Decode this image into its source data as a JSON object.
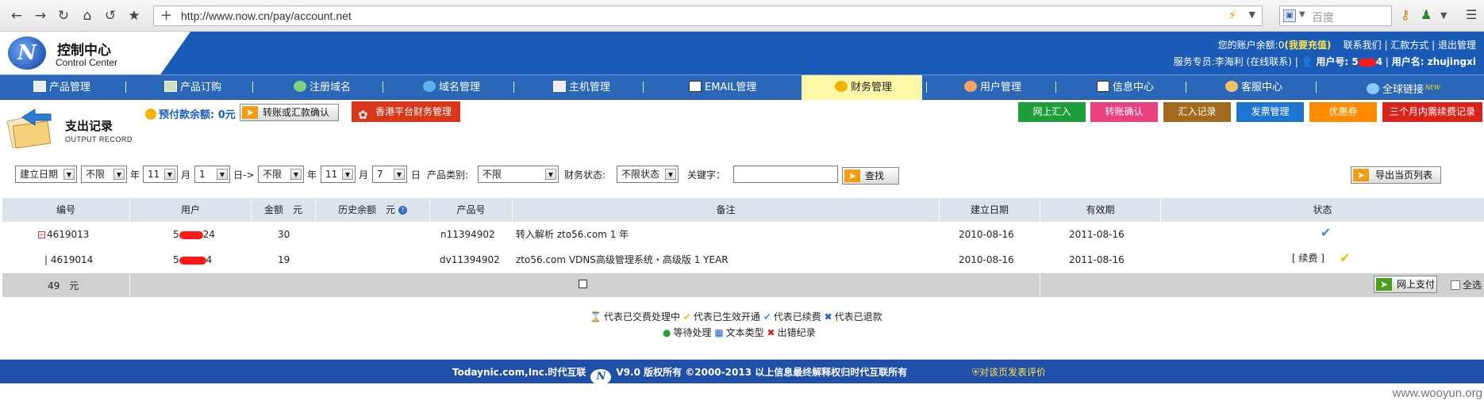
{
  "browser": {
    "url": "http://www.now.cn/pay/account.net",
    "search_placeholder": "百度"
  },
  "header": {
    "logo_cn": "控制中心",
    "logo_en": "Control Center",
    "balance_text": "您的账户余额:0",
    "recharge_link": "(我要充值)",
    "contact_link": "联系我们",
    "remit_link": "汇款方式",
    "logout_link": "退出管理",
    "service_text": "服务专员:李海利 (在线联系)",
    "account_no_label": "用户号: 5",
    "account_no_tail": "4",
    "username_label": "用户名: zhujingxi"
  },
  "nav": [
    {
      "label": "产品管理"
    },
    {
      "label": "产品订购"
    },
    {
      "label": "注册域名"
    },
    {
      "label": "域名管理"
    },
    {
      "label": "主机管理"
    },
    {
      "label": "EMAIL管理"
    },
    {
      "label": "财务管理"
    },
    {
      "label": "用户管理"
    },
    {
      "label": "信息中心"
    },
    {
      "label": "客服中心"
    },
    {
      "label": "全球链接"
    }
  ],
  "page": {
    "title": "支出记录",
    "subtitle": "OUTPUT RECORD",
    "prepaid_label": "预付款余额: 0元",
    "transfer_button": "转账或汇款确认",
    "hk_button": "香港平台财务管理"
  },
  "quick_buttons": [
    {
      "label": "网上汇入",
      "color": "#1e9e3a"
    },
    {
      "label": "转账确认",
      "color": "#e8417e"
    },
    {
      "label": "汇入记录",
      "color": "#a26a1c"
    },
    {
      "label": "发票管理",
      "color": "#1f76d1"
    },
    {
      "label": "优惠券",
      "color": "#ff8c00"
    },
    {
      "label": "三个月内需续费记录",
      "color": "#d9241c"
    }
  ],
  "filters": {
    "date_type": "建立日期",
    "from_year": "不限",
    "year_label": "年",
    "from_month": "11",
    "month_label": "月",
    "from_day": "1",
    "day_to_label": "日->",
    "to_year": "不限",
    "to_year_label": "年",
    "to_month": "11",
    "to_month_label": "月",
    "to_day": "7",
    "to_day_label": "日",
    "product_type_label": "产品类别:",
    "product_type": "不限",
    "finance_status_label": "财务状态:",
    "finance_status": "不限状态",
    "keyword_label": "关键字：",
    "keyword_value": "",
    "search_button": "查找",
    "export_button": "导出当页列表"
  },
  "table": {
    "headers": [
      "编号",
      "用户",
      "金额　元",
      "历史余额　元",
      "产品号",
      "备注",
      "建立日期",
      "有效期",
      "状态"
    ],
    "rows": [
      {
        "id": "4619013",
        "user_prefix": "5",
        "user_suffix": "24",
        "amount": "30",
        "history": "",
        "product_no": "n11394902",
        "note": "转入解析 zto56.com 1 年",
        "created": "2010-08-16",
        "expires": "2011-08-16",
        "status_extra": ""
      },
      {
        "id": "4619014",
        "user_prefix": "5",
        "user_suffix": "4",
        "amount": "19",
        "history": "",
        "product_no": "dv11394902",
        "note": "zto56.com VDNS高级管理系统・高级版 1 YEAR",
        "created": "2010-08-16",
        "expires": "2011-08-16",
        "status_extra": "[ 续费 ]"
      }
    ],
    "total": "49　元",
    "pay_button": "网上支付",
    "select_all": "全选"
  },
  "legend": {
    "item1": "代表已交费处理中",
    "item2": "代表已生效开通",
    "item3": "代表已续费",
    "item4": "代表已退款",
    "item5": "等待处理",
    "item6": "文本类型",
    "item7": "出错纪录"
  },
  "footer": {
    "company": "Todaynic.com,Inc.时代互联",
    "copyright": "V9.0 版权所有 ©2000-2013  以上信息最终解释权归时代互联所有",
    "review": "对该页发表评价"
  },
  "watermark": "www.wooyun.org"
}
